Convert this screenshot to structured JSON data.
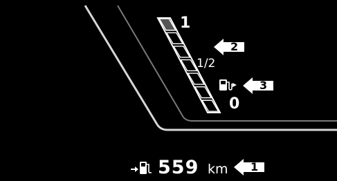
{
  "fuel_gauge": {
    "scale_full": "1",
    "scale_half": "1/2",
    "scale_empty": "0",
    "fill_level": 0.14,
    "segment_count": 7,
    "colors": {
      "empty_segment": "#ffffff",
      "filled_segment": "#555555",
      "background": "#000000"
    }
  },
  "callouts": {
    "gauge": "2",
    "fuel_cap_indicator": "3",
    "range": "1"
  },
  "range_display": {
    "value": "559",
    "unit": "km",
    "icon": "fuel-pump-arrow-icon"
  }
}
